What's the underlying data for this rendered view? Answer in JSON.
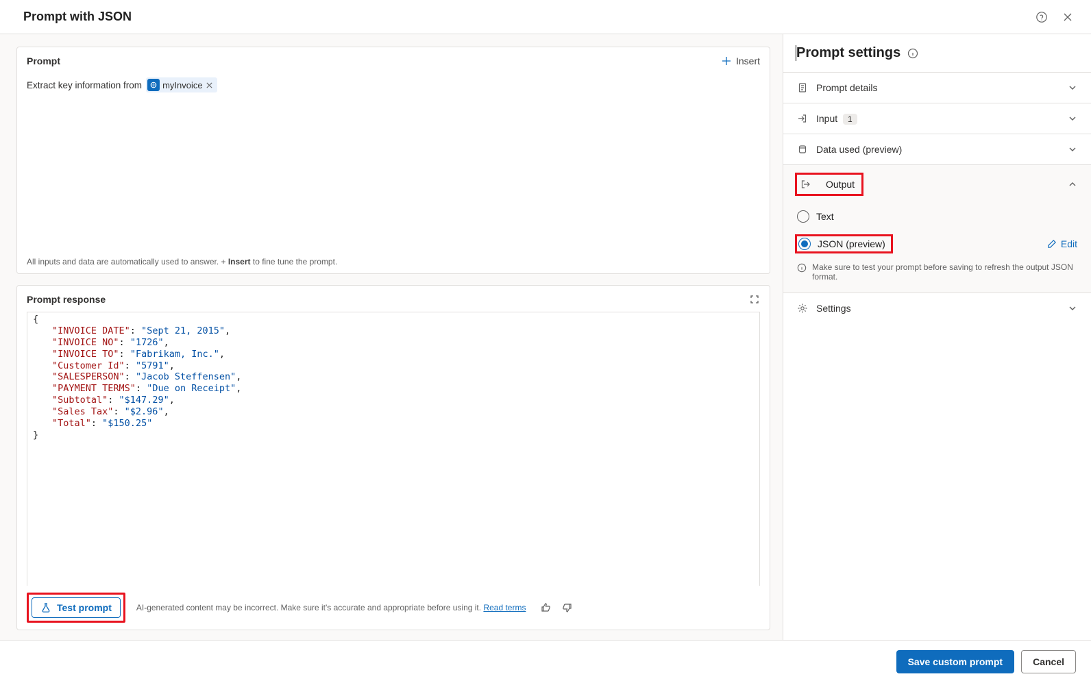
{
  "header": {
    "title": "Prompt with JSON"
  },
  "prompt": {
    "section_title": "Prompt",
    "insert_label": "Insert",
    "prefix_text": "Extract key information from ",
    "chip_label": "myInvoice",
    "footer_before": "All inputs and data are automatically used to answer. + ",
    "footer_bold": "Insert",
    "footer_after": " to fine tune the prompt."
  },
  "response": {
    "section_title": "Prompt response",
    "json_pairs": [
      {
        "k": "INVOICE DATE",
        "v": "Sept 21, 2015"
      },
      {
        "k": "INVOICE NO",
        "v": "1726"
      },
      {
        "k": "INVOICE TO",
        "v": "Fabrikam, Inc."
      },
      {
        "k": "Customer Id",
        "v": "5791"
      },
      {
        "k": "SALESPERSON",
        "v": "Jacob Steffensen"
      },
      {
        "k": "PAYMENT TERMS",
        "v": "Due on Receipt"
      },
      {
        "k": "Subtotal",
        "v": "$147.29"
      },
      {
        "k": "Sales Tax",
        "v": "$2.96"
      },
      {
        "k": "Total",
        "v": "$150.25"
      }
    ],
    "test_button": "Test prompt",
    "ai_note": "AI-generated content may be incorrect. Make sure it's accurate and appropriate before using it. ",
    "read_terms": "Read terms"
  },
  "settings": {
    "title": "Prompt settings",
    "sections": {
      "details": "Prompt details",
      "input": "Input",
      "input_count": "1",
      "data_used": "Data used (preview)",
      "output": "Output",
      "settings": "Settings"
    },
    "output_options": {
      "text": "Text",
      "json": "JSON (preview)",
      "edit": "Edit",
      "info": "Make sure to test your prompt before saving to refresh the output JSON format."
    }
  },
  "footer": {
    "save": "Save custom prompt",
    "cancel": "Cancel"
  }
}
